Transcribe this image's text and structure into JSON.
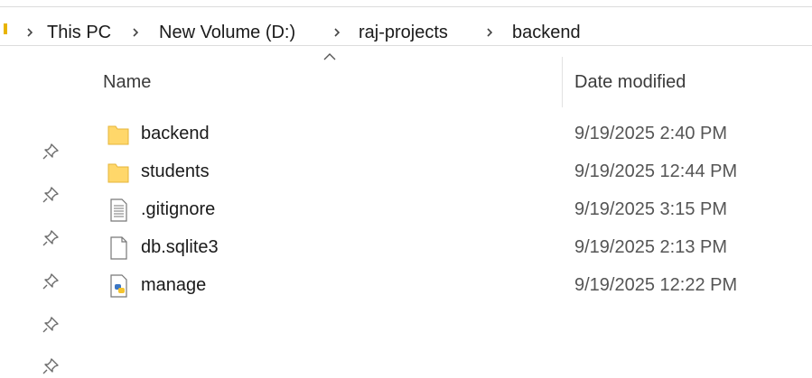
{
  "breadcrumb": {
    "items": [
      "This PC",
      "New Volume (D:)",
      "raj-projects",
      "backend"
    ]
  },
  "columns": {
    "name": "Name",
    "date_modified": "Date modified",
    "sort_indicator": "ascending"
  },
  "files": [
    {
      "name": "backend",
      "date": "9/19/2025 2:40 PM",
      "icon": "folder-icon"
    },
    {
      "name": "students",
      "date": "9/19/2025 12:44 PM",
      "icon": "folder-icon"
    },
    {
      "name": ".gitignore",
      "date": "9/19/2025 3:15 PM",
      "icon": "text-file-icon"
    },
    {
      "name": "db.sqlite3",
      "date": "9/19/2025 2:13 PM",
      "icon": "file-icon"
    },
    {
      "name": "manage",
      "date": "9/19/2025 12:22 PM",
      "icon": "python-file-icon"
    }
  ],
  "quick_access_pins": 6,
  "colors": {
    "folder": "#ffd76a",
    "folder_edge": "#e6b53a",
    "pin": "#6b6b6b"
  }
}
